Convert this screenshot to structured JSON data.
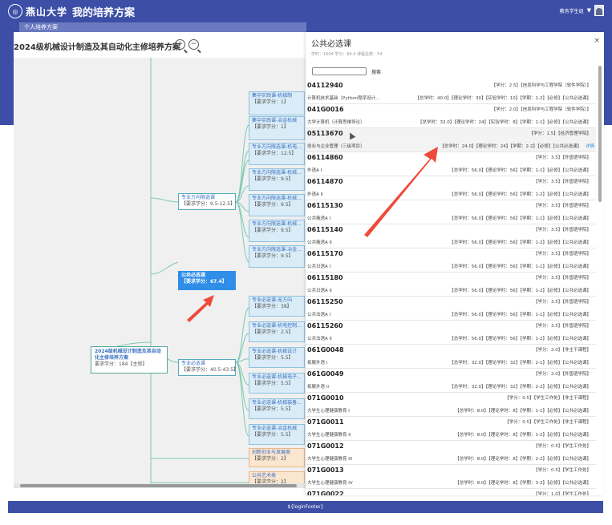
{
  "header": {
    "logo_text": "燕山大学",
    "app_title": "我的培养方案",
    "user_label": "教务学生组"
  },
  "subnav": {
    "label": "个人培养方案"
  },
  "plan": {
    "title": "2024级机械设计制造及其自动化主修培养方案"
  },
  "tree": {
    "root": {
      "title_line1": "2024级机械设计制造及其自动",
      "title_line2": "化主修培养方案",
      "meta": "要求学分：184【主修】"
    },
    "elective_dir": {
      "title": "专业方向限选课",
      "meta": "【要求学分：9.5-12.5】"
    },
    "public_required": {
      "title": "公共必选课",
      "meta": "【要求学分：67.4】"
    },
    "major_required": {
      "title": "专业必选课",
      "meta": "【要求学分：40.5-43.5】"
    },
    "top_nodes": [
      {
        "title": "集中实践课-机械制",
        "meta": "【要求学分：1】"
      },
      {
        "title": "集中实践课-冶金机械",
        "meta": "【要求学分：1】"
      }
    ],
    "dir_nodes": [
      {
        "title": "专业方向限选课-机电...",
        "meta": "【要求学分：12.5】"
      },
      {
        "title": "专业方向限选课-机械...",
        "meta": "【要求学分：9.5】"
      },
      {
        "title": "专业方向限选课-机械...",
        "meta": "【要求学分：9.5】"
      },
      {
        "title": "专业方向限选课-机械...",
        "meta": "【要求学分：9.5】"
      },
      {
        "title": "专业方向限选课-冶金...",
        "meta": "【要求学分：9.5】"
      }
    ],
    "req_nodes": [
      {
        "title": "专业必选课-无方向",
        "meta": "【要求学分：38】"
      },
      {
        "title": "专业必选课-机电控制...",
        "meta": "【要求学分：2.5】"
      },
      {
        "title": "专业必选课-机械设计",
        "meta": "【要求学分：5.5】"
      },
      {
        "title": "专业必选课-机械电子...",
        "meta": "【要求学分：5.5】"
      },
      {
        "title": "专业必选课-机械装备...",
        "meta": "【要求学分：5.5】"
      },
      {
        "title": "专业必选课-冶金机械",
        "meta": "【要求学分：5.5】"
      }
    ],
    "other_nodes": [
      {
        "title": "创新创业与发展类",
        "meta": "【要求学分：2】"
      },
      {
        "title": "公共艺术类",
        "meta": "【要求学分：2】"
      },
      {
        "title": "数学与逻辑类",
        "meta": ""
      }
    ]
  },
  "drawer": {
    "title": "公共必选课",
    "stats": "学时：1604   学分：84.4   课程总数：54",
    "search_label": "搜索",
    "close_label": "×",
    "detail_label": "详情",
    "courses": [
      {
        "code": "04112940",
        "name": "计算机技术基础（Python程序设计...",
        "r1": "【学分：2.5】【信息科学与工程学院（软件学院）】",
        "r2": "【总学时：40.0】【理论学时：30】【实验学时：10】【学期：1-2】【必修】【公共必选课】"
      },
      {
        "code": "041G0016",
        "name": "大学计算机（计算思维导论）",
        "r1": "【学分：2.0】【信息科学与工程学院（软件学院）】",
        "r2": "【总学时：32.0】【理论学时：24】【实验学时：8】【学期：1-1】【必修】【公共必选课】"
      },
      {
        "code": "05113670",
        "name": "创业与企业管理（三级项目）",
        "r1": "【学分：1.5】【经济管理学院】",
        "r2": "【总学时：24.0】【理论学时：24】【学期：2-2】【必修】【公共必选课】",
        "highlight": true
      },
      {
        "code": "06114860",
        "name": "外语A I",
        "r1": "【学分：3.5】【外国语学院】",
        "r2": "【总学时：56.0】【理论学时：56】【学期：1-1】【必修】【公共必选课】"
      },
      {
        "code": "06114870",
        "name": "外语A II",
        "r1": "【学分：3.5】【外国语学院】",
        "r2": "【总学时：56.0】【理论学时：56】【学期：1-2】【必修】【公共必选课】"
      },
      {
        "code": "06115130",
        "name": "公共俄语A I",
        "r1": "【学分：3.5】【外国语学院】",
        "r2": "【总学时：56.0】【理论学时：56】【学期：1-1】【必修】【公共必选课】"
      },
      {
        "code": "06115140",
        "name": "公共俄语A II",
        "r1": "【学分：3.5】【外国语学院】",
        "r2": "【总学时：56.0】【理论学时：56】【学期：1-2】【必修】【公共必选课】"
      },
      {
        "code": "06115170",
        "name": "公共日语A I",
        "r1": "【学分：3.5】【外国语学院】",
        "r2": "【总学时：56.0】【理论学时：56】【学期：1-1】【必修】【公共必选课】"
      },
      {
        "code": "06115180",
        "name": "公共日语A II",
        "r1": "【学分：3.5】【外国语学院】",
        "r2": "【总学时：56.0】【理论学时：56】【学期：1-2】【必修】【公共必选课】"
      },
      {
        "code": "06115250",
        "name": "公共法语A I",
        "r1": "【学分：3.5】【外国语学院】",
        "r2": "【总学时：56.0】【理论学时：56】【学期：1-1】【必修】【公共必选课】"
      },
      {
        "code": "06115260",
        "name": "公共法语A II",
        "r1": "【学分：3.5】【外国语学院】",
        "r2": "【总学时：56.0】【理论学时：56】【学期：1-2】【必修】【公共必选课】"
      },
      {
        "code": "061G0048",
        "name": "拓展外语 I",
        "r1": "【学分：2.0】【非主干课程】",
        "r2": "【总学时：32.0】【理论学时：32】【学期：2-1】【必修】【公共必选课】"
      },
      {
        "code": "061G0049",
        "name": "拓展外语 II",
        "r1": "【学分：2.0】【外国语学院】",
        "r2": "【总学时：32.0】【理论学时：32】【学期：2-2】【必修】【公共必选课】"
      },
      {
        "code": "071G0010",
        "name": "大学生心理健康教育 I",
        "r1": "【学分：0.5】【学生工作处】【非主干课程】",
        "r2": "【总学时：8.0】【理论学时：8】【学期：1-1】【必修】【公共必选课】"
      },
      {
        "code": "071G0011",
        "name": "大学生心理健康教育 II",
        "r1": "【学分：0.5】【学生工作处】【非主干课程】",
        "r2": "【总学时：8.0】【理论学时：8】【学期：1-2】【必修】【公共必选课】"
      },
      {
        "code": "071G0012",
        "name": "大学生心理健康教育 III",
        "r1": "【学分：0.5】【学生工作处】",
        "r2": "【总学时：8.0】【理论学时：8】【学期：2-2】【必修】【公共必选课】"
      },
      {
        "code": "071G0013",
        "name": "大学生心理健康教育 IV",
        "r1": "【学分：0.5】【学生工作处】",
        "r2": "【总学时：8.0】【理论学时：8】【学期：3-2】【必修】【公共必选课】"
      },
      {
        "code": "071G0022",
        "name": "",
        "r1": "【学分：1.0】【学生工作处】",
        "r2": ""
      }
    ]
  },
  "footer": {
    "text": "${loginFooter}"
  },
  "colors": {
    "primary": "#3c4ea5",
    "selected_node": "#2e8ee8",
    "arrow": "#f04a3a"
  }
}
